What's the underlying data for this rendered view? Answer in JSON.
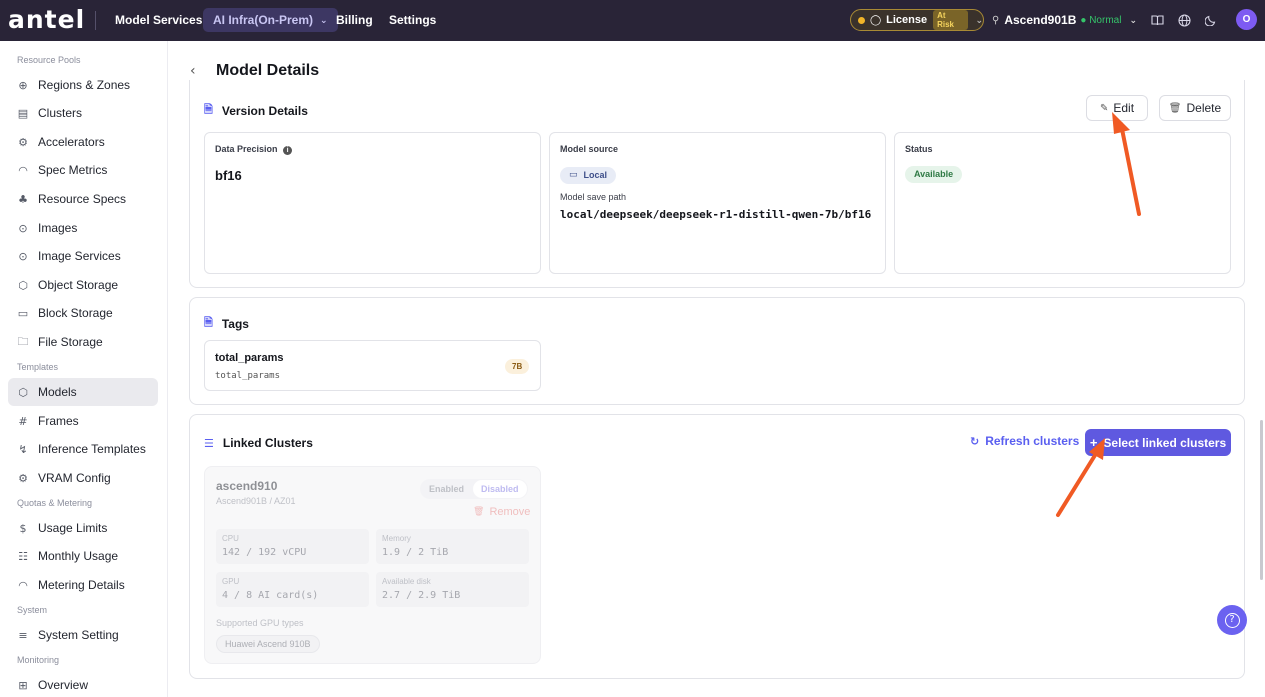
{
  "topbar": {
    "logo": "antel",
    "nav": [
      "Model Services",
      "AI Infra(On-Prem)",
      "Billing",
      "Settings"
    ],
    "license_label": "License",
    "license_status": "At Risk",
    "cluster_name": "Ascend901B",
    "cluster_status": "Normal",
    "avatar_initial": "O",
    "colors": {
      "bg": "#292437",
      "active_nav": "#3d3763",
      "status_ok": "#35c46a",
      "warn": "#f0b429"
    }
  },
  "sidebar": {
    "groups": {
      "resource_pools": "Resource Pools",
      "templates": "Templates",
      "quotas": "Quotas & Metering",
      "system": "System",
      "monitoring": "Monitoring"
    },
    "items": [
      {
        "label": "Regions & Zones",
        "icon": "globe-icon"
      },
      {
        "label": "Clusters",
        "icon": "server-icon"
      },
      {
        "label": "Accelerators",
        "icon": "chip-icon"
      },
      {
        "label": "Spec Metrics",
        "icon": "gauge-icon"
      },
      {
        "label": "Resource Specs",
        "icon": "spec-icon"
      },
      {
        "label": "Images",
        "icon": "disc-icon"
      },
      {
        "label": "Image Services",
        "icon": "disc-icon"
      },
      {
        "label": "Object Storage",
        "icon": "cube-icon"
      },
      {
        "label": "Block Storage",
        "icon": "drive-icon"
      },
      {
        "label": "File Storage",
        "icon": "folder-icon"
      },
      {
        "label": "Models",
        "icon": "cube-icon",
        "active": true
      },
      {
        "label": "Frames",
        "icon": "frame-icon"
      },
      {
        "label": "Inference Templates",
        "icon": "bolt-icon"
      },
      {
        "label": "VRAM Config",
        "icon": "gear-icon"
      },
      {
        "label": "Usage Limits",
        "icon": "dollar-icon"
      },
      {
        "label": "Monthly Usage",
        "icon": "calendar-icon"
      },
      {
        "label": "Metering Details",
        "icon": "gauge-icon"
      },
      {
        "label": "System Setting",
        "icon": "layers-icon"
      },
      {
        "label": "Overview",
        "icon": "grid-icon"
      }
    ]
  },
  "page": {
    "title": "Model Details"
  },
  "version_details": {
    "title": "Version Details",
    "edit_label": "Edit",
    "delete_label": "Delete",
    "data_precision_label": "Data Precision",
    "data_precision_value": "bf16",
    "model_source_label": "Model source",
    "model_source_value": "Local",
    "save_path_label": "Model save path",
    "save_path_value": "local/deepseek/deepseek-r1-distill-qwen-7b/bf16",
    "status_label": "Status",
    "status_value": "Available"
  },
  "tags": {
    "title": "Tags",
    "items": [
      {
        "name": "total_params",
        "key": "total_params",
        "value": "7B"
      }
    ]
  },
  "linked_clusters": {
    "title": "Linked Clusters",
    "refresh_label": "Refresh clusters",
    "select_label": "Select linked clusters",
    "cluster": {
      "name": "ascend910",
      "location": "Ascend901B / AZ01",
      "enabled_label": "Enabled",
      "disabled_label": "Disabled",
      "remove_label": "Remove",
      "cpu_label": "CPU",
      "cpu_value": "142 / 192 vCPU",
      "memory_label": "Memory",
      "memory_value": "1.9 / 2 TiB",
      "gpu_label": "GPU",
      "gpu_value": "4 / 8 AI card(s)",
      "disk_label": "Available disk",
      "disk_value": "2.7 / 2.9 TiB",
      "gpu_types_label": "Supported GPU types",
      "gpu_type": "Huawei Ascend 910B"
    }
  },
  "accent_colors": {
    "primary": "#5f59e0",
    "annotation_arrow": "#f05a24"
  }
}
